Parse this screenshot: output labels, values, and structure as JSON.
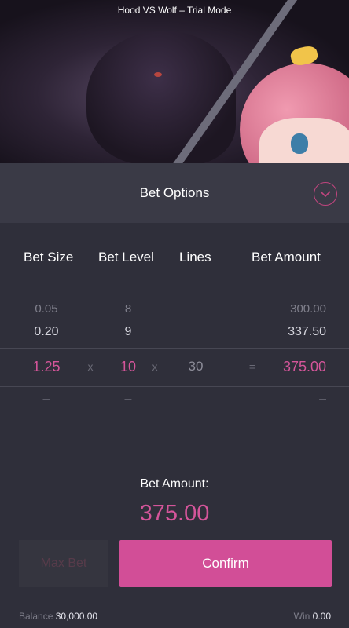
{
  "header": {
    "title": "Hood VS Wolf – Trial Mode"
  },
  "panel": {
    "title": "Bet Options"
  },
  "columns": {
    "bet_size": "Bet Size",
    "bet_level": "Bet Level",
    "lines": "Lines",
    "bet_amount": "Bet Amount"
  },
  "picker": {
    "bet_size": [
      "0.05",
      "0.20",
      "1.25",
      "–"
    ],
    "bet_level": [
      "8",
      "9",
      "10",
      "–"
    ],
    "lines": "30",
    "bet_amount": [
      "300.00",
      "337.50",
      "375.00",
      "–"
    ],
    "ops": {
      "times": "x",
      "equals": "="
    }
  },
  "summary": {
    "label": "Bet Amount:",
    "value": "375.00"
  },
  "buttons": {
    "max_bet": "Max Bet",
    "confirm": "Confirm"
  },
  "footer": {
    "balance_label": "Balance",
    "balance_value": "30,000.00",
    "win_label": "Win",
    "win_value": "0.00"
  },
  "colors": {
    "accent": "#d24e97",
    "panel_bg": "#2f2f3a"
  },
  "icons": {
    "collapse": "chevron-down-circle-icon"
  }
}
